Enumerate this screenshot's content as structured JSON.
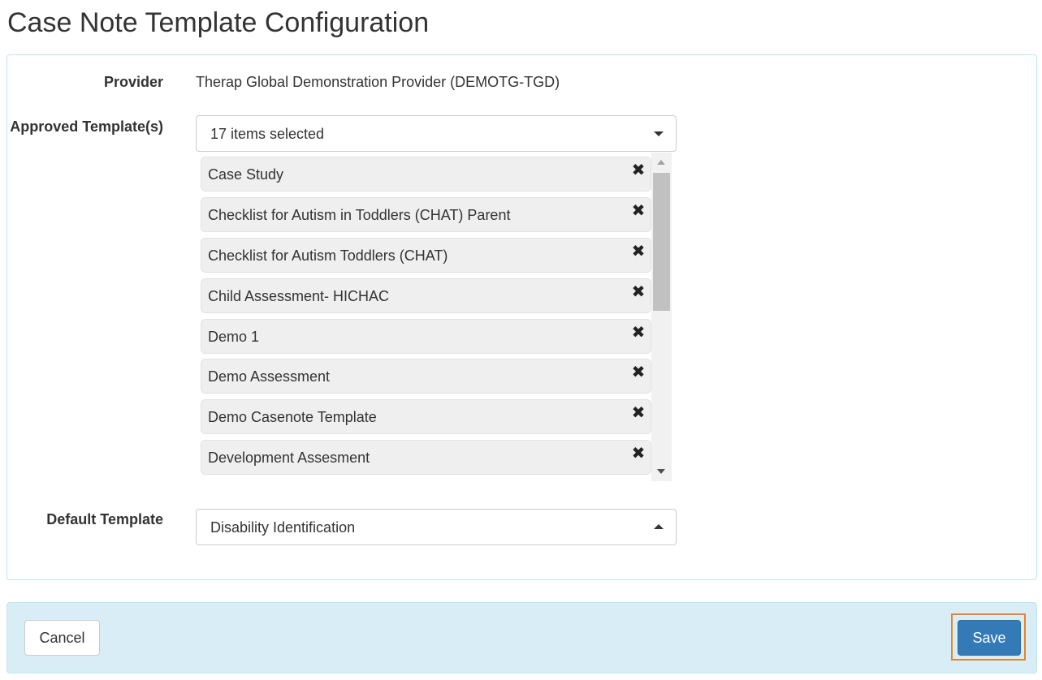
{
  "page": {
    "title": "Case Note Template Configuration"
  },
  "form": {
    "provider": {
      "label": "Provider",
      "value": "Therap Global Demonstration Provider (DEMOTG-TGD)"
    },
    "approved_templates": {
      "label": "Approved Template(s)",
      "summary": "17 items selected",
      "selected_items": [
        {
          "label": "Case Study"
        },
        {
          "label": "Checklist for Autism in Toddlers (CHAT) Parent"
        },
        {
          "label": "Checklist for Autism Toddlers (CHAT)"
        },
        {
          "label": "Child Assessment- HICHAC"
        },
        {
          "label": "Demo 1"
        },
        {
          "label": "Demo Assessment"
        },
        {
          "label": "Demo Casenote Template"
        },
        {
          "label": "Development Assesment"
        }
      ],
      "remove_icon": "close-icon"
    },
    "default_template": {
      "label": "Default Template",
      "value": "Disability Identification"
    }
  },
  "footer": {
    "cancel_label": "Cancel",
    "save_label": "Save"
  },
  "colors": {
    "primary": "#337ab7",
    "panel_border": "#bce8f1",
    "footer_bg": "#d9edf7",
    "focus_ring": "#e8832a",
    "chip_bg": "#efefef"
  }
}
